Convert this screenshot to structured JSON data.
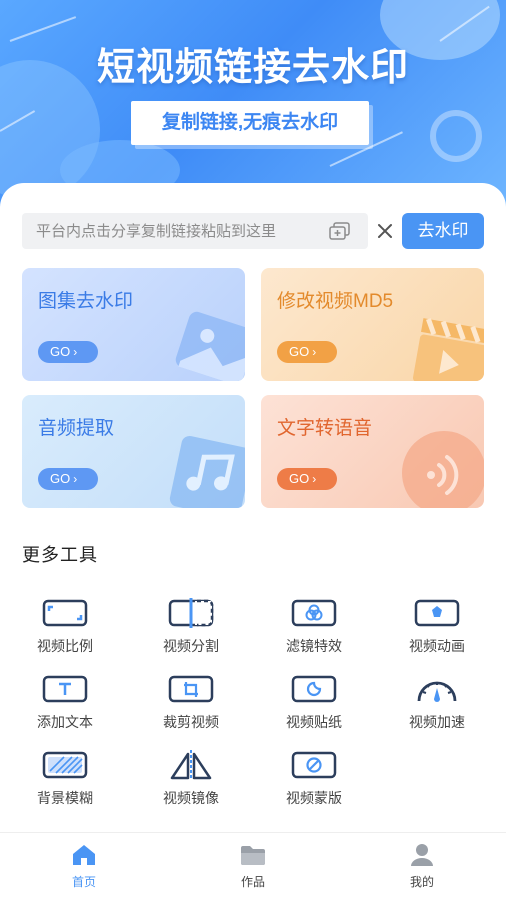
{
  "hero": {
    "title": "短视频链接去水印",
    "subtitle": "复制链接,无痕去水印"
  },
  "search": {
    "placeholder": "平台内点击分享复制链接粘贴到这里",
    "value": "",
    "button_label": "去水印"
  },
  "feature_cards": [
    {
      "title": "图集去水印",
      "go": "GO"
    },
    {
      "title": "修改视频MD5",
      "go": "GO"
    },
    {
      "title": "音频提取",
      "go": "GO"
    },
    {
      "title": "文字转语音",
      "go": "GO"
    }
  ],
  "more_tools": {
    "title": "更多工具",
    "items": [
      {
        "label": "视频比例",
        "icon": "aspect-ratio-icon"
      },
      {
        "label": "视频分割",
        "icon": "split-icon"
      },
      {
        "label": "滤镜特效",
        "icon": "filter-icon"
      },
      {
        "label": "视频动画",
        "icon": "animation-icon"
      },
      {
        "label": "添加文本",
        "icon": "text-icon"
      },
      {
        "label": "裁剪视频",
        "icon": "crop-icon"
      },
      {
        "label": "视频贴纸",
        "icon": "sticker-icon"
      },
      {
        "label": "视频加速",
        "icon": "speedometer-icon"
      },
      {
        "label": "背景模糊",
        "icon": "blur-icon"
      },
      {
        "label": "视频镜像",
        "icon": "mirror-icon"
      },
      {
        "label": "视频蒙版",
        "icon": "mask-icon"
      }
    ]
  },
  "tabbar": {
    "items": [
      {
        "label": "首页",
        "icon": "home-icon",
        "active": true
      },
      {
        "label": "作品",
        "icon": "folder-icon",
        "active": false
      },
      {
        "label": "我的",
        "icon": "user-icon",
        "active": false
      }
    ]
  },
  "colors": {
    "accent": "#4a95f4",
    "hero_blue": "#3f8cf7",
    "icon_navy": "#2c3e5c"
  }
}
